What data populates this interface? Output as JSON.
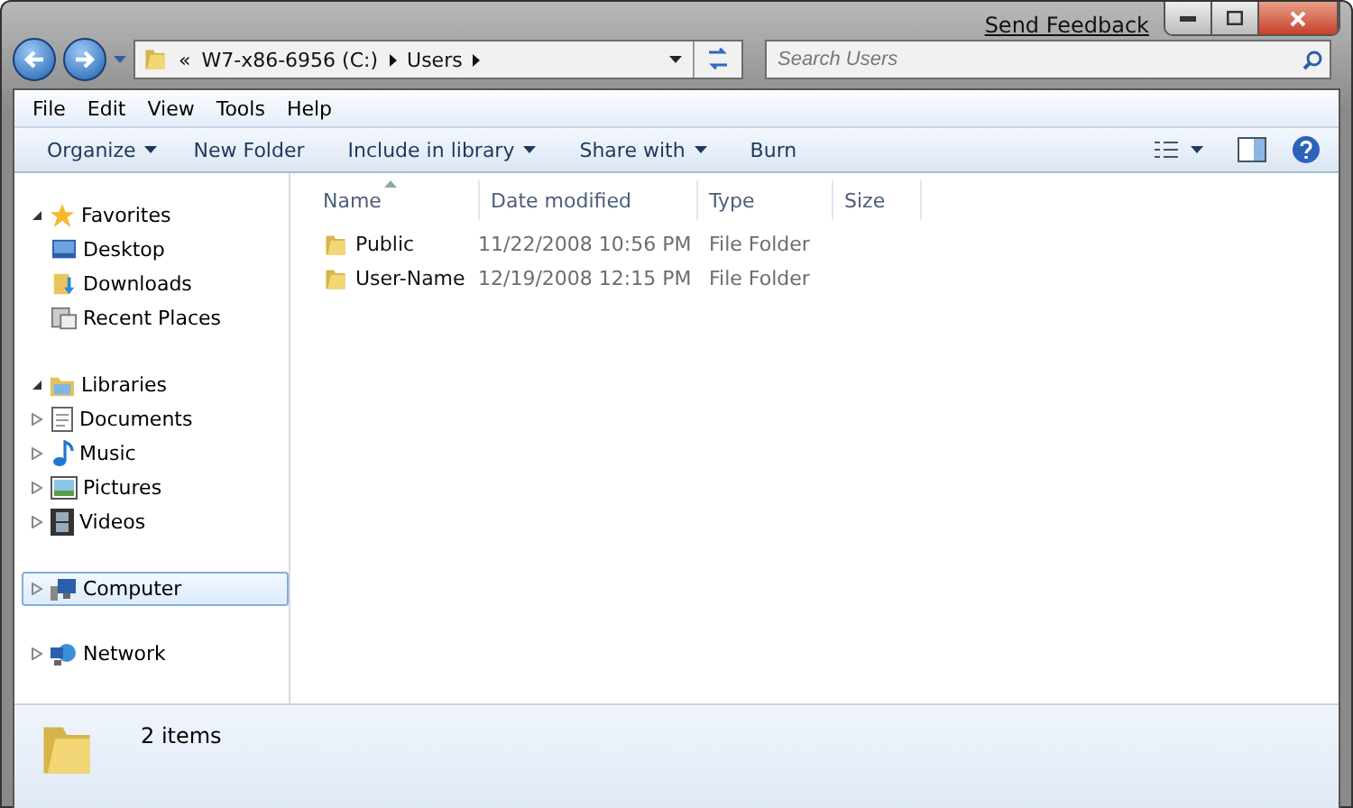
{
  "title_bar": {
    "link": "Send Feedback"
  },
  "address": {
    "overflow": "«",
    "crumbs": [
      "W7-x86-6956 (C:)",
      "Users"
    ],
    "search_placeholder": "Search Users"
  },
  "menu": [
    "File",
    "Edit",
    "View",
    "Tools",
    "Help"
  ],
  "commands": [
    {
      "label": "Organize",
      "dropdown": true
    },
    {
      "label": "New Folder",
      "dropdown": false
    },
    {
      "label": "Include in library",
      "dropdown": true
    },
    {
      "label": "Share with",
      "dropdown": true
    },
    {
      "label": "Burn",
      "dropdown": false
    }
  ],
  "nav": [
    {
      "label": "Favorites",
      "expanded": true,
      "selected": false,
      "children": [
        {
          "label": "Desktop",
          "expandable": false
        },
        {
          "label": "Downloads",
          "expandable": false
        },
        {
          "label": "Recent Places",
          "expandable": false
        }
      ]
    },
    {
      "label": "Libraries",
      "expanded": true,
      "selected": false,
      "children": [
        {
          "label": "Documents",
          "expandable": true
        },
        {
          "label": "Music",
          "expandable": true
        },
        {
          "label": "Pictures",
          "expandable": true
        },
        {
          "label": "Videos",
          "expandable": true
        }
      ]
    },
    {
      "label": "Computer",
      "expanded": false,
      "selected": true
    },
    {
      "label": "Network",
      "expanded": false,
      "selected": false
    }
  ],
  "table": {
    "columns": [
      {
        "label": "Name",
        "sorted": true
      },
      {
        "label": "Date modified",
        "sorted": false
      },
      {
        "label": "Type",
        "sorted": false
      },
      {
        "label": "Size",
        "sorted": false
      }
    ],
    "rows": [
      {
        "name": "Public",
        "date": "11/22/2008 10:56 PM",
        "type": "File Folder"
      },
      {
        "name": "User-Name",
        "date": "12/19/2008 12:15 PM",
        "type": "File Folder"
      }
    ]
  },
  "status_bar": {
    "count": "2 items"
  }
}
